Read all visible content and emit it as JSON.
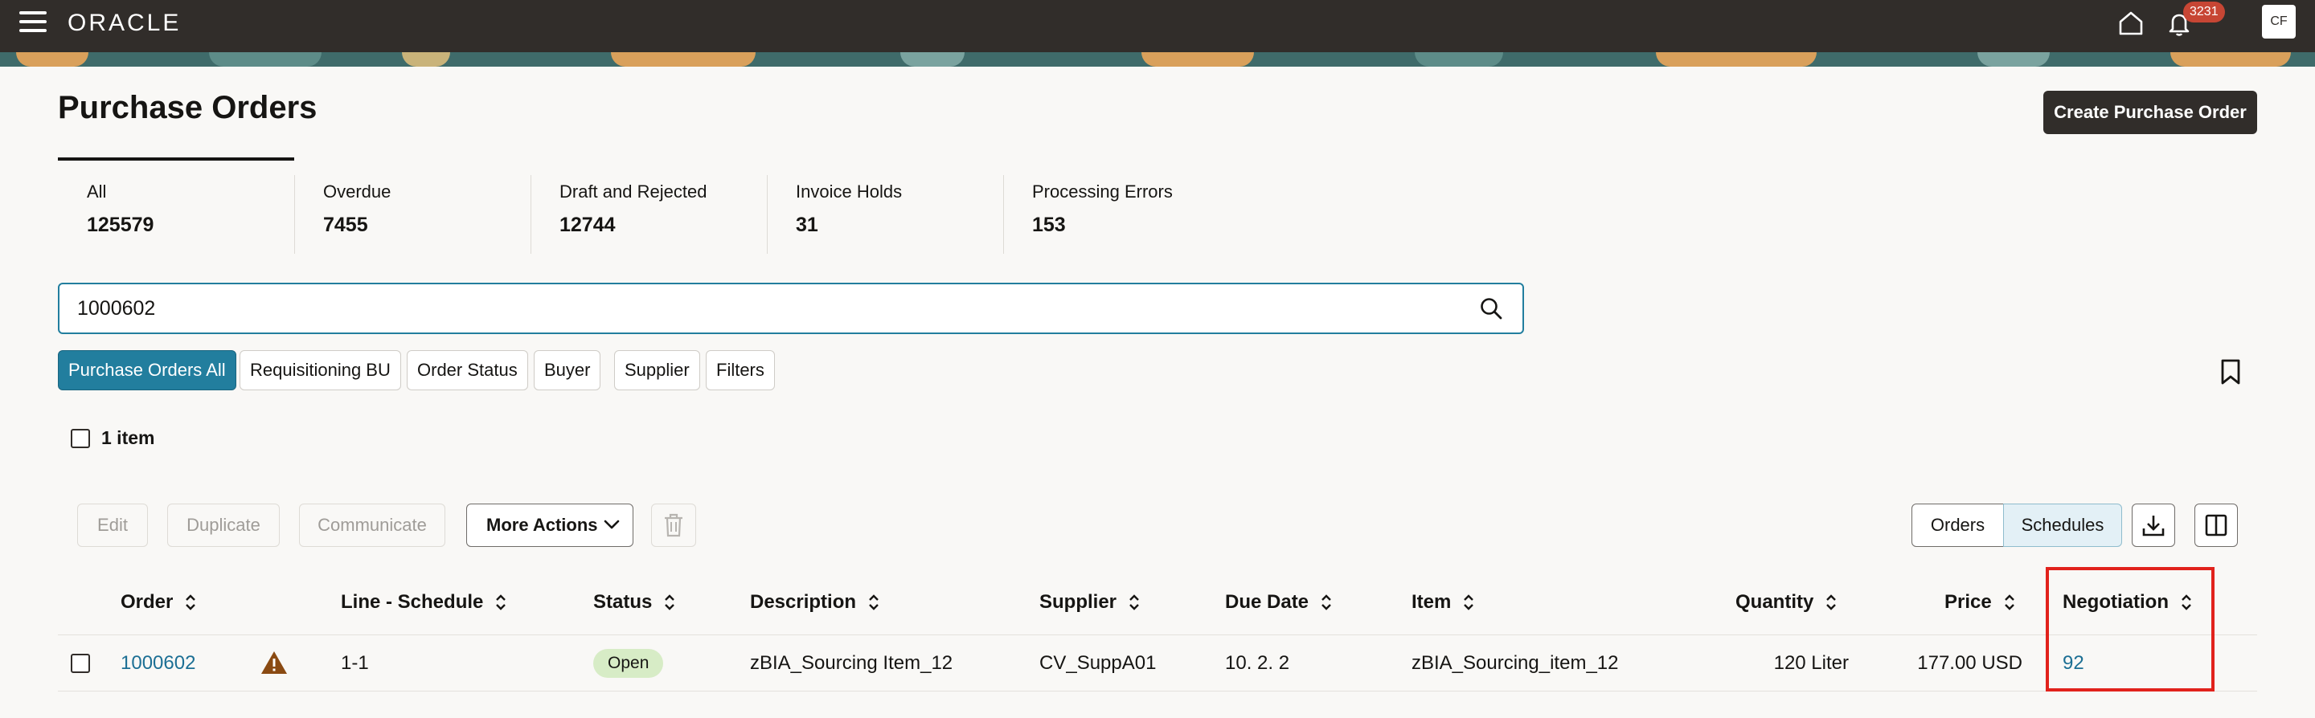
{
  "header": {
    "logo": "ORACLE",
    "notifications_count": "3231",
    "user_initials": "CF"
  },
  "page": {
    "title": "Purchase Orders",
    "create_button": "Create Purchase Order"
  },
  "summary": [
    {
      "label": "All",
      "count": "125579"
    },
    {
      "label": "Overdue",
      "count": "7455"
    },
    {
      "label": "Draft and Rejected",
      "count": "12744"
    },
    {
      "label": "Invoice Holds",
      "count": "31"
    },
    {
      "label": "Processing Errors",
      "count": "153"
    }
  ],
  "search": {
    "value": "1000602"
  },
  "filters": [
    {
      "label": "Purchase Orders All",
      "active": true
    },
    {
      "label": "Requisitioning BU",
      "active": false
    },
    {
      "label": "Order Status",
      "active": false
    },
    {
      "label": "Buyer",
      "active": false
    },
    {
      "label": "Supplier",
      "active": false
    },
    {
      "label": "Filters",
      "active": false
    }
  ],
  "results": {
    "count_label": "1 item"
  },
  "toolbar": {
    "edit": "Edit",
    "duplicate": "Duplicate",
    "communicate": "Communicate",
    "more_actions": "More Actions",
    "view_orders": "Orders",
    "view_schedules": "Schedules"
  },
  "table": {
    "columns": [
      "Order",
      "Line - Schedule",
      "Status",
      "Description",
      "Supplier",
      "Due Date",
      "Item",
      "Quantity",
      "Price",
      "Negotiation"
    ],
    "rows": [
      {
        "order": "1000602",
        "line_schedule": "1-1",
        "status": "Open",
        "description": "zBIA_Sourcing Item_12",
        "supplier": "CV_SuppA01",
        "due_date": "10. 2. 2",
        "item": "zBIA_Sourcing_item_12",
        "quantity": "120 Liter",
        "price": "177.00 USD",
        "negotiation": "92"
      }
    ]
  },
  "colors": {
    "topbar": "#312d2a",
    "accent": "#227e9e",
    "link": "#1c6f94",
    "status_open_bg": "#d7ecc6",
    "badge": "#c74634",
    "highlight": "#e1221c"
  }
}
